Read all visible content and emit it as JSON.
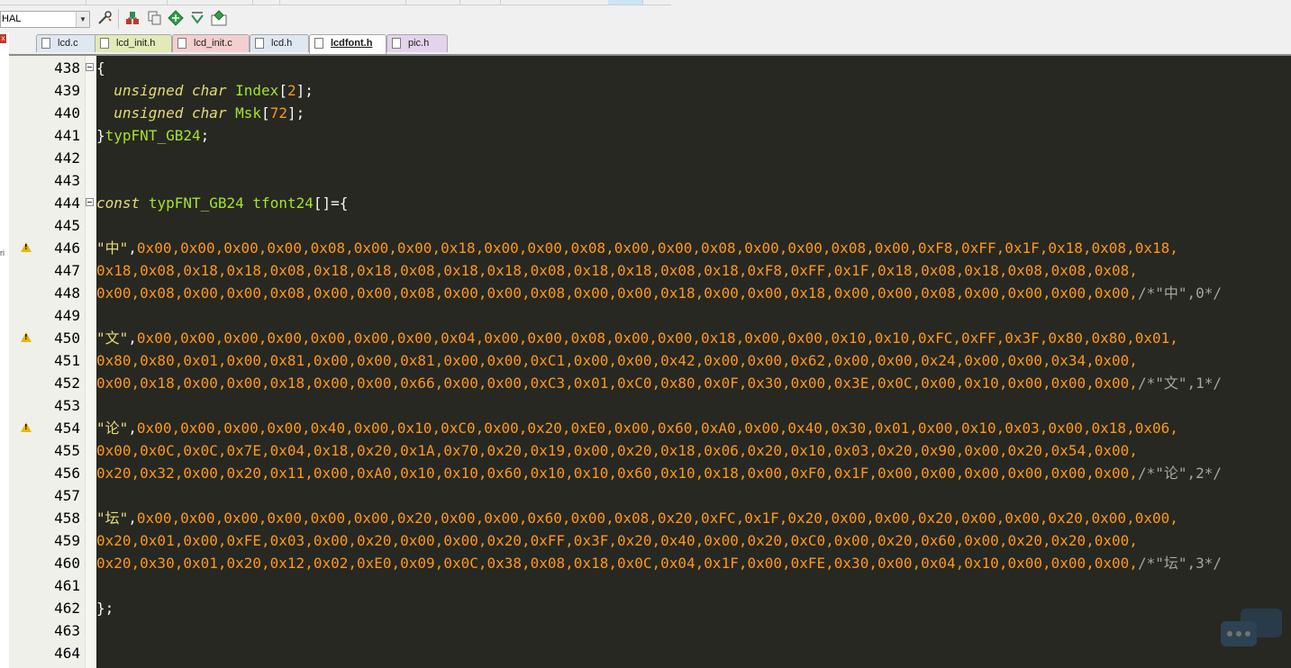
{
  "toolbar": {
    "target": "HAL",
    "icons": [
      "wrench-icon",
      "manage-run-icon",
      "copy-icon",
      "diamond-icon",
      "arrow-icon",
      "manage-components-icon"
    ]
  },
  "tabs": [
    {
      "label": "lcd.c",
      "color": "#dfe8f0",
      "active": false
    },
    {
      "label": "lcd_init.h",
      "color": "#e2eab8",
      "active": false
    },
    {
      "label": "lcd_init.c",
      "color": "#f4cfcf",
      "active": false
    },
    {
      "label": "lcd.h",
      "color": "#dfe8f0",
      "active": false
    },
    {
      "label": "lcdfont.h",
      "color": "#fdfdfd",
      "active": true
    },
    {
      "label": "pic.h",
      "color": "#e2d4ea",
      "active": false
    }
  ],
  "editor": {
    "lines": [
      {
        "n": "438",
        "fold": true,
        "warn": false,
        "tokens": [
          [
            "{",
            "t-punct"
          ]
        ]
      },
      {
        "n": "439",
        "fold": false,
        "warn": false,
        "tokens": [
          [
            "  ",
            "t-plain"
          ],
          [
            "unsigned char",
            "t-kw"
          ],
          [
            " ",
            "t-plain"
          ],
          [
            "Index",
            "t-type"
          ],
          [
            "[",
            "t-punct"
          ],
          [
            "2",
            "t-num"
          ],
          [
            "];",
            "t-punct"
          ]
        ]
      },
      {
        "n": "440",
        "fold": false,
        "warn": false,
        "tokens": [
          [
            "  ",
            "t-plain"
          ],
          [
            "unsigned char",
            "t-kw"
          ],
          [
            " ",
            "t-plain"
          ],
          [
            "Msk",
            "t-type"
          ],
          [
            "[",
            "t-punct"
          ],
          [
            "72",
            "t-num"
          ],
          [
            "];",
            "t-punct"
          ]
        ]
      },
      {
        "n": "441",
        "fold": false,
        "warn": false,
        "tokens": [
          [
            "}",
            "t-punct"
          ],
          [
            "typFNT_GB24",
            "t-type"
          ],
          [
            ";",
            "t-punct"
          ]
        ]
      },
      {
        "n": "442",
        "fold": false,
        "warn": false,
        "tokens": []
      },
      {
        "n": "443",
        "fold": false,
        "warn": false,
        "tokens": []
      },
      {
        "n": "444",
        "fold": true,
        "warn": false,
        "tokens": [
          [
            "const",
            "t-kw"
          ],
          [
            " ",
            "t-plain"
          ],
          [
            "typFNT_GB24",
            "t-type"
          ],
          [
            " ",
            "t-plain"
          ],
          [
            "tfont24",
            "t-type"
          ],
          [
            "[]={",
            "t-punct"
          ]
        ]
      },
      {
        "n": "445",
        "fold": false,
        "warn": false,
        "tokens": []
      },
      {
        "n": "446",
        "fold": false,
        "warn": true,
        "tokens": [
          [
            "\"中\"",
            "t-str"
          ],
          [
            ",",
            "t-punct"
          ],
          [
            "0x00,0x00,0x00,0x00,0x08,0x00,0x00,0x18,0x00,0x00,0x08,0x00,0x00,0x08,0x00,0x00,0x08,0x00,0xF8,0xFF,0x1F,0x18,0x08,0x18,",
            "t-num"
          ]
        ]
      },
      {
        "n": "447",
        "fold": false,
        "warn": false,
        "tokens": [
          [
            "0x18,0x08,0x18,0x18,0x08,0x18,0x18,0x08,0x18,0x18,0x08,0x18,0x18,0x08,0x18,0xF8,0xFF,0x1F,0x18,0x08,0x18,0x08,0x08,0x08,",
            "t-num"
          ]
        ]
      },
      {
        "n": "448",
        "fold": false,
        "warn": false,
        "tokens": [
          [
            "0x00,0x08,0x00,0x00,0x08,0x00,0x00,0x08,0x00,0x00,0x08,0x00,0x00,0x18,0x00,0x00,0x18,0x00,0x00,0x08,0x00,0x00,0x00,0x00,",
            "t-num"
          ],
          [
            "/*\"中\",0*/",
            "t-com"
          ]
        ]
      },
      {
        "n": "449",
        "fold": false,
        "warn": false,
        "tokens": []
      },
      {
        "n": "450",
        "fold": false,
        "warn": true,
        "tokens": [
          [
            "\"文\"",
            "t-str"
          ],
          [
            ",",
            "t-punct"
          ],
          [
            "0x00,0x00,0x00,0x00,0x00,0x00,0x00,0x04,0x00,0x00,0x08,0x00,0x00,0x18,0x00,0x00,0x10,0x10,0xFC,0xFF,0x3F,0x80,0x80,0x01,",
            "t-num"
          ]
        ]
      },
      {
        "n": "451",
        "fold": false,
        "warn": false,
        "tokens": [
          [
            "0x80,0x80,0x01,0x00,0x81,0x00,0x00,0x81,0x00,0x00,0xC1,0x00,0x00,0x42,0x00,0x00,0x62,0x00,0x00,0x24,0x00,0x00,0x34,0x00,",
            "t-num"
          ]
        ]
      },
      {
        "n": "452",
        "fold": false,
        "warn": false,
        "tokens": [
          [
            "0x00,0x18,0x00,0x00,0x18,0x00,0x00,0x66,0x00,0x00,0xC3,0x01,0xC0,0x80,0x0F,0x30,0x00,0x3E,0x0C,0x00,0x10,0x00,0x00,0x00,",
            "t-num"
          ],
          [
            "/*\"文\",1*/",
            "t-com"
          ]
        ]
      },
      {
        "n": "453",
        "fold": false,
        "warn": false,
        "tokens": []
      },
      {
        "n": "454",
        "fold": false,
        "warn": true,
        "tokens": [
          [
            "\"论\"",
            "t-str"
          ],
          [
            ",",
            "t-punct"
          ],
          [
            "0x00,0x00,0x00,0x00,0x40,0x00,0x10,0xC0,0x00,0x20,0xE0,0x00,0x60,0xA0,0x00,0x40,0x30,0x01,0x00,0x10,0x03,0x00,0x18,0x06,",
            "t-num"
          ]
        ]
      },
      {
        "n": "455",
        "fold": false,
        "warn": false,
        "tokens": [
          [
            "0x00,0x0C,0x0C,0x7E,0x04,0x18,0x20,0x1A,0x70,0x20,0x19,0x00,0x20,0x18,0x06,0x20,0x10,0x03,0x20,0x90,0x00,0x20,0x54,0x00,",
            "t-num"
          ]
        ]
      },
      {
        "n": "456",
        "fold": false,
        "warn": false,
        "tokens": [
          [
            "0x20,0x32,0x00,0x20,0x11,0x00,0xA0,0x10,0x10,0x60,0x10,0x10,0x60,0x10,0x18,0x00,0xF0,0x1F,0x00,0x00,0x00,0x00,0x00,0x00,",
            "t-num"
          ],
          [
            "/*\"论\",2*/",
            "t-com"
          ]
        ]
      },
      {
        "n": "457",
        "fold": false,
        "warn": false,
        "tokens": []
      },
      {
        "n": "458",
        "fold": false,
        "warn": false,
        "tokens": [
          [
            "\"坛\"",
            "t-str"
          ],
          [
            ",",
            "t-punct"
          ],
          [
            "0x00,0x00,0x00,0x00,0x00,0x00,0x20,0x00,0x00,0x60,0x00,0x08,0x20,0xFC,0x1F,0x20,0x00,0x00,0x20,0x00,0x00,0x20,0x00,0x00,",
            "t-num"
          ]
        ]
      },
      {
        "n": "459",
        "fold": false,
        "warn": false,
        "tokens": [
          [
            "0x20,0x01,0x00,0xFE,0x03,0x00,0x20,0x00,0x00,0x20,0xFF,0x3F,0x20,0x40,0x00,0x20,0xC0,0x00,0x20,0x60,0x00,0x20,0x20,0x00,",
            "t-num"
          ]
        ]
      },
      {
        "n": "460",
        "fold": false,
        "warn": false,
        "tokens": [
          [
            "0x20,0x30,0x01,0x20,0x12,0x02,0xE0,0x09,0x0C,0x38,0x08,0x18,0x0C,0x04,0x1F,0x00,0xFE,0x30,0x00,0x04,0x10,0x00,0x00,0x00,",
            "t-num"
          ],
          [
            "/*\"坛\",3*/",
            "t-com"
          ]
        ]
      },
      {
        "n": "461",
        "fold": false,
        "warn": false,
        "tokens": []
      },
      {
        "n": "462",
        "fold": false,
        "warn": false,
        "tokens": [
          [
            "};",
            "t-punct"
          ]
        ]
      },
      {
        "n": "463",
        "fold": false,
        "warn": false,
        "tokens": []
      },
      {
        "n": "464",
        "fold": false,
        "warn": false,
        "tokens": []
      }
    ]
  }
}
